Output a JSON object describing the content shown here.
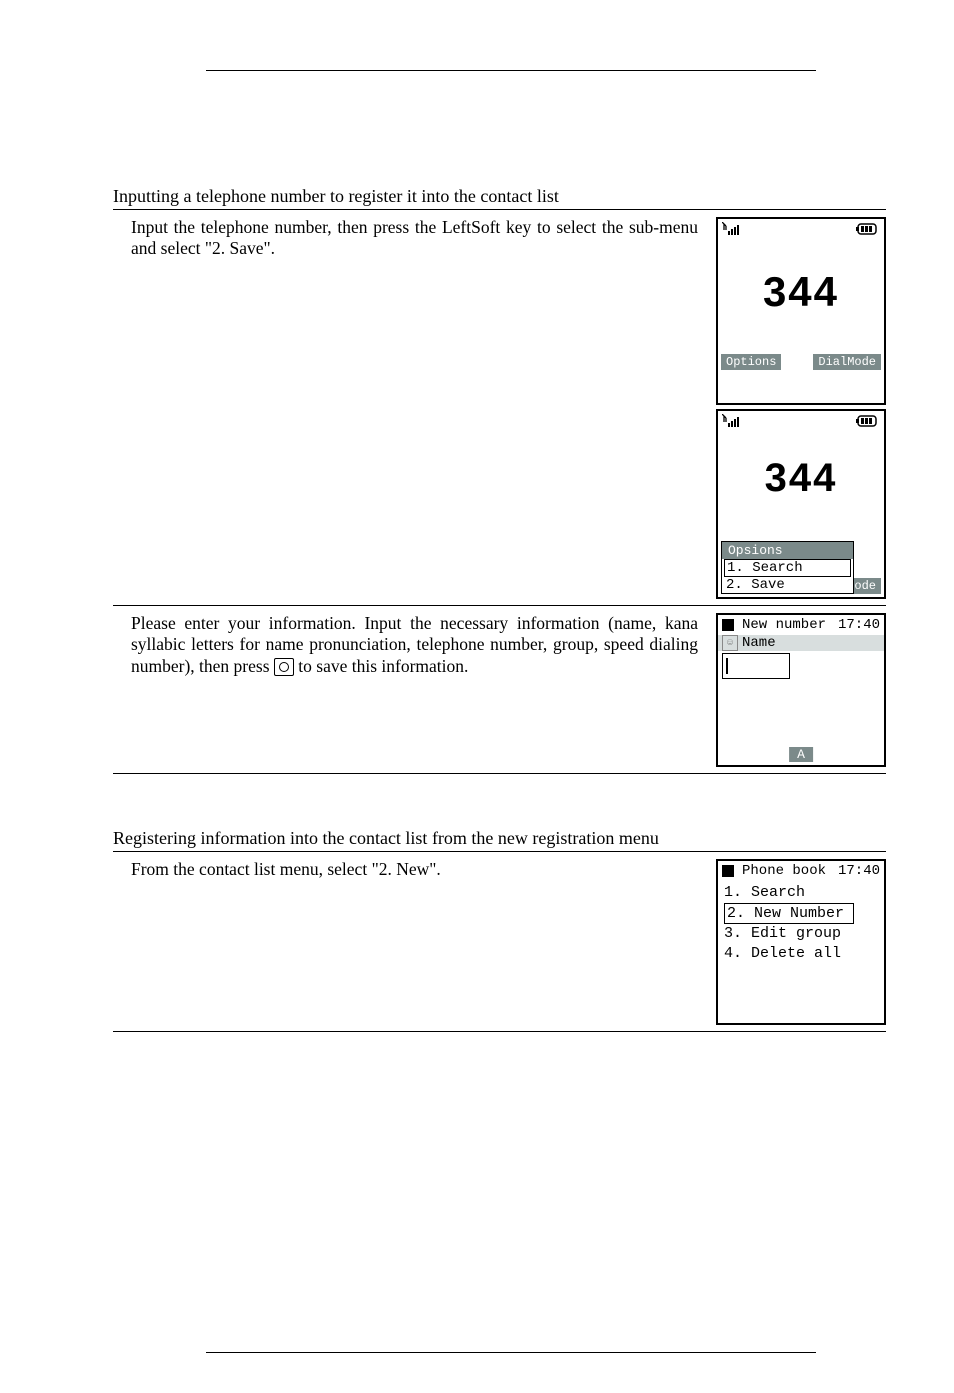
{
  "section1": {
    "heading": "Inputting a telephone number to register it into the contact list",
    "step1_desc": "Input the telephone number, then press the LeftSoft key to select the sub-menu and select \"2. Save\".",
    "step2_desc_pre": "Please enter your information. Input the necessary information (name, kana syllabic letters for name pronunciation, telephone number, group, speed dialing number), then press ",
    "step2_desc_post": " to save this information."
  },
  "section2": {
    "heading": "Registering information into the contact list from the new registration menu",
    "step1_desc": "From the contact list menu, select \"2. New\"."
  },
  "screen_dial": {
    "number": "344",
    "soft_left": "Options",
    "soft_right": "DialMode"
  },
  "screen_options": {
    "number_partial": "344",
    "popup_title": "Opsions",
    "item1": "1. Search",
    "item2": "2. Save",
    "soft_right_fragment": "ialMode"
  },
  "screen_newnumber": {
    "title": "New number",
    "time": "17:40",
    "field_label": "Name",
    "mode": "A"
  },
  "screen_phonebook": {
    "title": "Phone book",
    "time": "17:40",
    "items": [
      "1. Search",
      "2. New Number",
      "3. Edit group",
      "4. Delete all"
    ]
  }
}
